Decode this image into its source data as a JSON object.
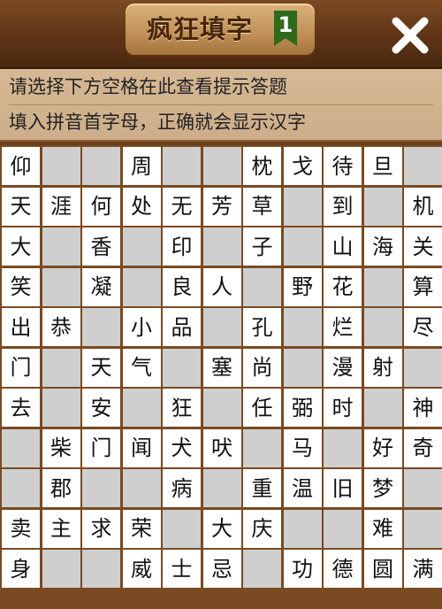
{
  "header": {
    "title": "疯狂填字",
    "level": "1"
  },
  "hints": [
    "请选择下方空格在此查看提示答题",
    "填入拼音首字母，正确就会显示汉字"
  ],
  "grid": {
    "rows": [
      [
        "仰",
        "",
        "",
        "周",
        "",
        "",
        "枕",
        "戈",
        "待",
        "旦",
        ""
      ],
      [
        "天",
        "涯",
        "何",
        "处",
        "无",
        "芳",
        "草",
        "",
        "到",
        "",
        "机"
      ],
      [
        "大",
        "",
        "香",
        "",
        "印",
        "",
        "子",
        "",
        "山",
        "海",
        "关"
      ],
      [
        "笑",
        "",
        "凝",
        "",
        "良",
        "人",
        "",
        "野",
        "花",
        "",
        "算"
      ],
      [
        "出",
        "恭",
        "",
        "小",
        "品",
        "",
        "孔",
        "",
        "烂",
        "",
        "尽"
      ],
      [
        "门",
        "",
        "天",
        "气",
        "",
        "塞",
        "尚",
        "",
        "漫",
        "射",
        ""
      ],
      [
        "去",
        "",
        "安",
        "",
        "狂",
        "",
        "任",
        "弼",
        "时",
        "",
        "神"
      ],
      [
        "",
        "柴",
        "门",
        "闻",
        "犬",
        "吠",
        "",
        "马",
        "",
        "好",
        "奇"
      ],
      [
        "",
        "郡",
        "",
        "",
        "病",
        "",
        "重",
        "温",
        "旧",
        "梦",
        ""
      ],
      [
        "卖",
        "主",
        "求",
        "荣",
        "",
        "大",
        "庆",
        "",
        "",
        "难",
        ""
      ],
      [
        "身",
        "",
        "",
        "威",
        "士",
        "忌",
        "",
        "功",
        "德",
        "圆",
        "满"
      ]
    ]
  }
}
